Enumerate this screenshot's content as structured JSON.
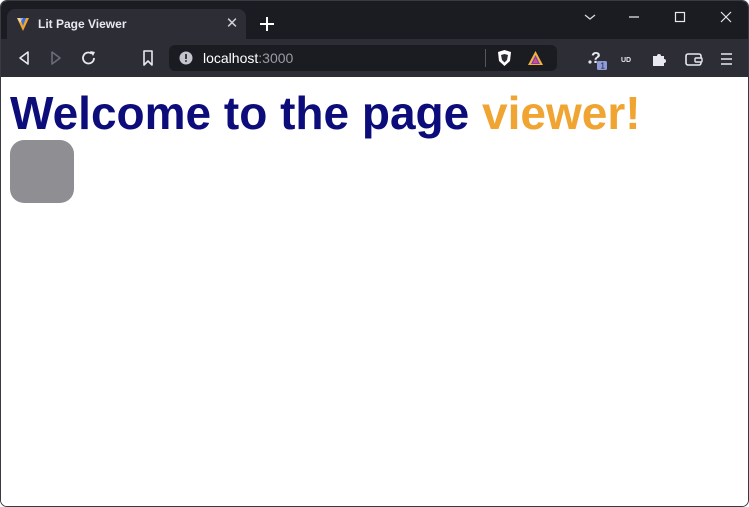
{
  "browser": {
    "tab": {
      "title": "Lit Page Viewer",
      "favicon": "lit-flame-icon",
      "close": "✕"
    },
    "new_tab_icon": "plus-icon",
    "window_controls": [
      "tab-search-icon",
      "minimize-icon",
      "maximize-icon",
      "close-icon"
    ],
    "toolbar": {
      "back_icon": "back-icon",
      "forward_icon": "forward-icon",
      "reload_icon": "reload-icon",
      "bookmark_icon": "bookmark-icon"
    },
    "address_bar": {
      "host": "localhost",
      "port": ":3000",
      "info_icon": "info-icon",
      "shields_icon": "brave-shields-icon",
      "rewards_icon": "brave-rewards-icon"
    },
    "extensions": {
      "help_icon": "help-icon",
      "help_badge": "1",
      "ud_label": "UD",
      "puzzle_icon": "extensions-icon",
      "wallet_icon": "wallet-icon",
      "menu_icon": "menu-icon"
    }
  },
  "page": {
    "heading": {
      "prefix": "Welcome to the ",
      "bold": "page",
      "space": " ",
      "accent": "viewer!"
    },
    "colors": {
      "heading": "#0c0c7a",
      "accent": "#f0a431",
      "box": "#8f8f93"
    }
  }
}
